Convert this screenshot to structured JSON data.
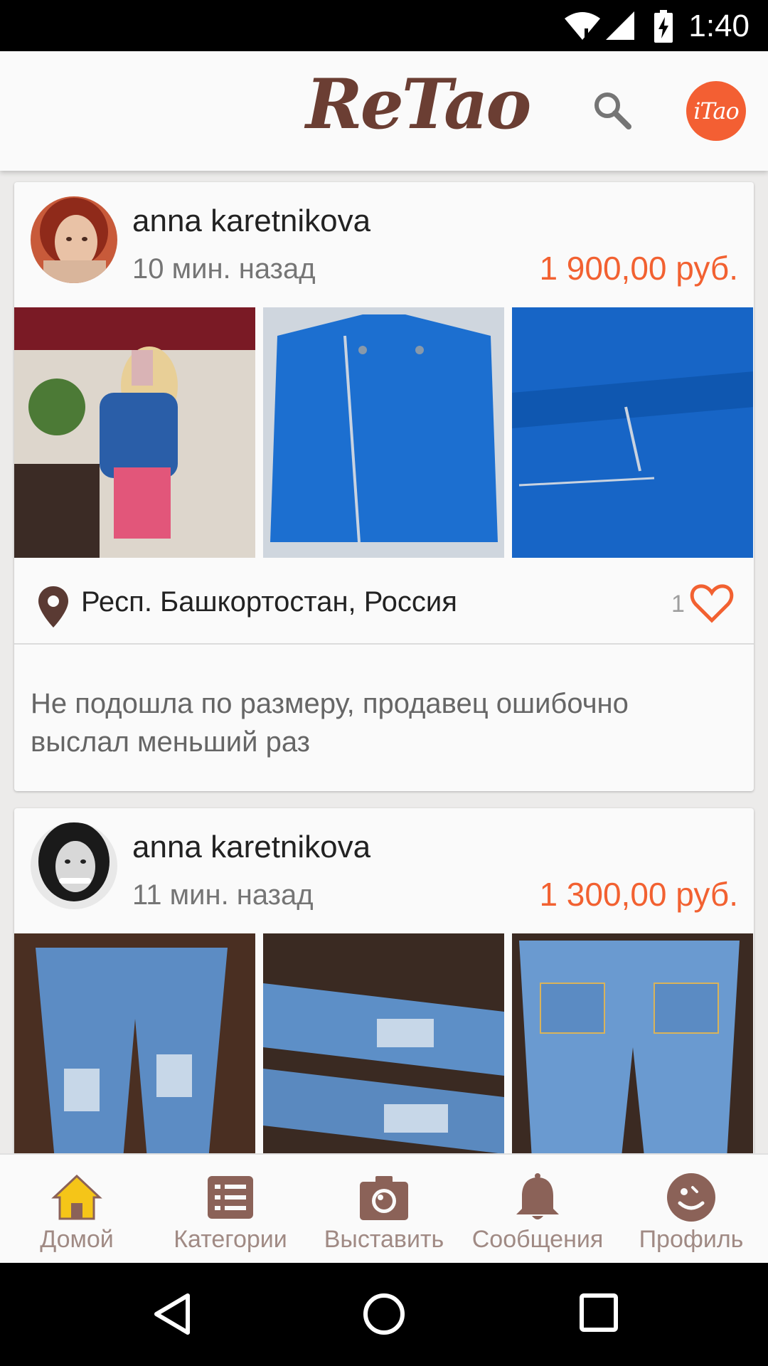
{
  "status_bar": {
    "time": "1:40"
  },
  "app_bar": {
    "logo": "ReTao",
    "search_icon": "search-icon",
    "itao_label": "iTao"
  },
  "posts": [
    {
      "username": "anna karetnikova",
      "time_ago": "10 мин. назад",
      "price": "1 900,00 руб.",
      "location": "Респ. Башкортостан, Россия",
      "likes": "1",
      "description": "Не подошла по размеру, продавец ошибочно выслал меньший раз"
    },
    {
      "username": "anna karetnikova",
      "time_ago": "11 мин. назад",
      "price": "1 300,00 руб."
    }
  ],
  "bottom_nav": [
    {
      "label": "Домой",
      "icon": "home-icon",
      "active": true
    },
    {
      "label": "Категории",
      "icon": "list-icon"
    },
    {
      "label": "Выставить",
      "icon": "camera-icon"
    },
    {
      "label": "Сообщения",
      "icon": "bell-icon"
    },
    {
      "label": "Профиль",
      "icon": "profile-face-icon"
    }
  ],
  "colors": {
    "accent": "#f26131",
    "brand": "#6b3e33",
    "nav_icon": "#8b6258",
    "home_icon": "#f5c518"
  }
}
